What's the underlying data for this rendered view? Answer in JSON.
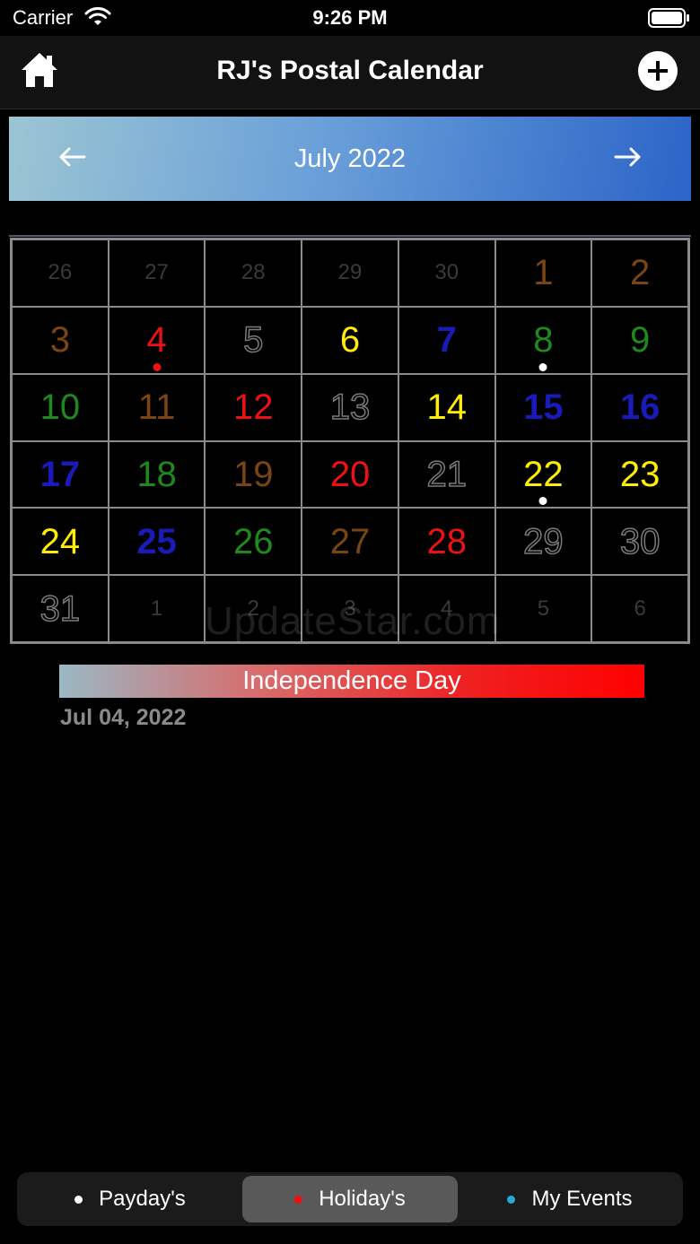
{
  "status_bar": {
    "carrier": "Carrier",
    "time": "9:26 PM"
  },
  "nav": {
    "title": "RJ's Postal Calendar"
  },
  "calendar": {
    "month_label": "July 2022",
    "days": [
      {
        "n": "26",
        "other": true
      },
      {
        "n": "27",
        "other": true
      },
      {
        "n": "28",
        "other": true
      },
      {
        "n": "29",
        "other": true
      },
      {
        "n": "30",
        "other": true
      },
      {
        "n": "1",
        "color": "brown"
      },
      {
        "n": "2",
        "color": "brown"
      },
      {
        "n": "3",
        "color": "brown"
      },
      {
        "n": "4",
        "color": "red",
        "dot": "#ee1111"
      },
      {
        "n": "5",
        "color": "gray"
      },
      {
        "n": "6",
        "color": "yellow"
      },
      {
        "n": "7",
        "color": "blue"
      },
      {
        "n": "8",
        "color": "green",
        "dot": "#ffffff"
      },
      {
        "n": "9",
        "color": "green"
      },
      {
        "n": "10",
        "color": "green"
      },
      {
        "n": "11",
        "color": "brown"
      },
      {
        "n": "12",
        "color": "red"
      },
      {
        "n": "13",
        "color": "gray"
      },
      {
        "n": "14",
        "color": "yellow"
      },
      {
        "n": "15",
        "color": "blue"
      },
      {
        "n": "16",
        "color": "blue"
      },
      {
        "n": "17",
        "color": "blue"
      },
      {
        "n": "18",
        "color": "green"
      },
      {
        "n": "19",
        "color": "brown"
      },
      {
        "n": "20",
        "color": "red"
      },
      {
        "n": "21",
        "color": "gray"
      },
      {
        "n": "22",
        "color": "yellow",
        "dot": "#ffffff"
      },
      {
        "n": "23",
        "color": "yellow"
      },
      {
        "n": "24",
        "color": "yellow"
      },
      {
        "n": "25",
        "color": "blue"
      },
      {
        "n": "26",
        "color": "green"
      },
      {
        "n": "27",
        "color": "brown"
      },
      {
        "n": "28",
        "color": "red"
      },
      {
        "n": "29",
        "color": "gray"
      },
      {
        "n": "30",
        "color": "gray"
      },
      {
        "n": "31",
        "color": "gray"
      },
      {
        "n": "1",
        "other": true
      },
      {
        "n": "2",
        "other": true
      },
      {
        "n": "3",
        "other": true
      },
      {
        "n": "4",
        "other": true
      },
      {
        "n": "5",
        "other": true
      },
      {
        "n": "6",
        "other": true
      }
    ]
  },
  "watermark": "UpdateStar.com",
  "event": {
    "title": "Independence Day",
    "date": "Jul 04, 2022"
  },
  "segments": [
    {
      "label": "Payday's",
      "dot_color": "#ffffff",
      "selected": false
    },
    {
      "label": "Holiday's",
      "dot_color": "#ee1111",
      "selected": true
    },
    {
      "label": "My Events",
      "dot_color": "#2aa6d6",
      "selected": false
    }
  ]
}
